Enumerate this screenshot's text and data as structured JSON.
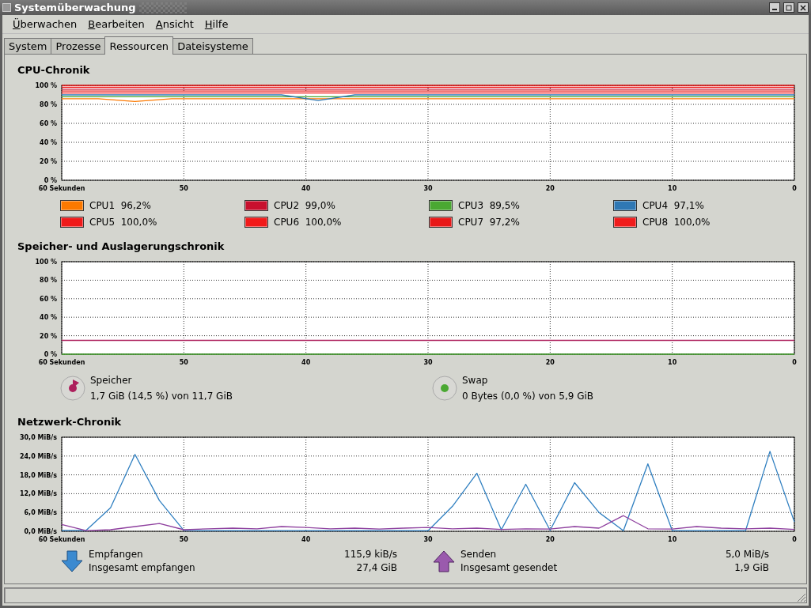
{
  "window": {
    "title": "Systemüberwachung"
  },
  "menu": [
    "Überwachen",
    "Bearbeiten",
    "Ansicht",
    "Hilfe"
  ],
  "tabs": [
    {
      "label": "System",
      "selected": false
    },
    {
      "label": "Prozesse",
      "selected": false
    },
    {
      "label": "Ressourcen",
      "selected": true
    },
    {
      "label": "Dateisysteme",
      "selected": false
    }
  ],
  "cpu": {
    "title": "CPU-Chronik",
    "chart_data": {
      "type": "line",
      "grid": true,
      "x": [
        60,
        57,
        54,
        51,
        48,
        45,
        42,
        39,
        36,
        33,
        30,
        27,
        24,
        21,
        18,
        15,
        12,
        9,
        6,
        3,
        0
      ],
      "xlim": [
        60,
        0
      ],
      "ylim": [
        0,
        100
      ],
      "xticks": [
        {
          "value": 60,
          "label": "60 Sekunden"
        },
        {
          "value": 50,
          "label": "50"
        },
        {
          "value": 40,
          "label": "40"
        },
        {
          "value": 30,
          "label": "30"
        },
        {
          "value": 20,
          "label": "20"
        },
        {
          "value": 10,
          "label": "10"
        },
        {
          "value": 0,
          "label": "0"
        }
      ],
      "yticks": [
        {
          "value": 0,
          "label": "0 %"
        },
        {
          "value": 20,
          "label": "20 %"
        },
        {
          "value": 40,
          "label": "40 %"
        },
        {
          "value": 60,
          "label": "60 %"
        },
        {
          "value": 80,
          "label": "80 %"
        },
        {
          "value": 100,
          "label": "100 %"
        }
      ],
      "series": [
        {
          "name": "CPU1",
          "color": "#fc7900",
          "values": [
            86,
            86,
            83,
            86,
            86,
            86,
            86,
            86,
            86,
            86,
            86,
            86,
            86,
            86,
            86,
            86,
            86,
            86,
            86,
            86,
            86
          ]
        },
        {
          "name": "CPU2",
          "color": "#c8102e",
          "values": [
            96,
            96,
            96,
            96,
            96,
            96,
            96,
            96,
            96,
            96,
            96,
            96,
            96,
            96,
            96,
            96,
            96,
            96,
            96,
            96,
            96
          ]
        },
        {
          "name": "CPU3",
          "color": "#4aa832",
          "values": [
            88,
            88,
            88,
            88,
            88,
            88,
            88,
            88,
            88,
            88,
            88,
            88,
            88,
            88,
            88,
            88,
            88,
            88,
            88,
            88,
            88
          ]
        },
        {
          "name": "CPU4",
          "color": "#2f78b4",
          "values": [
            90,
            90,
            90,
            90,
            90,
            90,
            90,
            84,
            90,
            90,
            90,
            90,
            90,
            90,
            90,
            90,
            90,
            90,
            90,
            90,
            90
          ]
        },
        {
          "name": "CPU5",
          "color": "#ef1a1a",
          "values": [
            98,
            98,
            98,
            98,
            98,
            98,
            98,
            98,
            98,
            98,
            98,
            98,
            98,
            98,
            98,
            98,
            98,
            98,
            98,
            98,
            98
          ]
        },
        {
          "name": "CPU6",
          "color": "#f21a1a",
          "values": [
            92,
            92,
            92,
            92,
            92,
            92,
            92,
            92,
            92,
            92,
            92,
            92,
            92,
            92,
            92,
            92,
            92,
            92,
            92,
            92,
            92
          ]
        },
        {
          "name": "CPU7",
          "color": "#e81818",
          "values": [
            94,
            94,
            94,
            94,
            94,
            94,
            94,
            94,
            94,
            94,
            94,
            94,
            94,
            94,
            94,
            94,
            94,
            94,
            94,
            94,
            94
          ]
        },
        {
          "name": "CPU8",
          "color": "#f01c1c",
          "values": [
            100,
            100,
            100,
            100,
            100,
            100,
            100,
            100,
            100,
            100,
            100,
            100,
            100,
            100,
            100,
            100,
            100,
            100,
            100,
            100,
            100
          ]
        }
      ]
    },
    "legend": [
      "96,2%",
      "99,0%",
      "89,5%",
      "97,1%",
      "100,0%",
      "100,0%",
      "97,2%",
      "100,0%"
    ]
  },
  "memory": {
    "title": "Speicher- und Auslagerungschronik",
    "chart_data": {
      "type": "line",
      "grid": true,
      "x": [
        60,
        0
      ],
      "xlim": [
        60,
        0
      ],
      "ylim": [
        0,
        100
      ],
      "xticks": [
        {
          "value": 60,
          "label": "60 Sekunden"
        },
        {
          "value": 50,
          "label": "50"
        },
        {
          "value": 40,
          "label": "40"
        },
        {
          "value": 30,
          "label": "30"
        },
        {
          "value": 20,
          "label": "20"
        },
        {
          "value": 10,
          "label": "10"
        },
        {
          "value": 0,
          "label": "0"
        }
      ],
      "yticks": [
        {
          "value": 0,
          "label": "0 %"
        },
        {
          "value": 20,
          "label": "20 %"
        },
        {
          "value": 40,
          "label": "40 %"
        },
        {
          "value": 60,
          "label": "60 %"
        },
        {
          "value": 80,
          "label": "80 %"
        },
        {
          "value": 100,
          "label": "100 %"
        }
      ],
      "series": [
        {
          "name": "Speicher",
          "color": "#ad1f5c",
          "values": [
            15,
            15
          ]
        },
        {
          "name": "Swap",
          "color": "#4aa832",
          "values": [
            0,
            0
          ]
        }
      ]
    },
    "legend": [
      "1,7 GiB (14,5 %) von 11,7 GiB",
      "0 Bytes (0,0 %) von 5,9 GiB"
    ]
  },
  "network": {
    "title": "Netzwerk-Chronik",
    "chart_data": {
      "type": "line",
      "grid": true,
      "x": [
        60,
        58,
        56,
        54,
        52,
        50,
        48,
        46,
        44,
        42,
        40,
        38,
        36,
        34,
        32,
        30,
        28,
        26,
        24,
        22,
        20,
        18,
        16,
        14,
        12,
        10,
        8,
        6,
        4,
        2,
        0
      ],
      "xlim": [
        60,
        0
      ],
      "ylim": [
        0,
        30
      ],
      "xticks": [
        {
          "value": 60,
          "label": "60 Sekunden"
        },
        {
          "value": 50,
          "label": "50"
        },
        {
          "value": 40,
          "label": "40"
        },
        {
          "value": 30,
          "label": "30"
        },
        {
          "value": 20,
          "label": "20"
        },
        {
          "value": 10,
          "label": "10"
        },
        {
          "value": 0,
          "label": "0"
        }
      ],
      "yticks": [
        {
          "value": 0,
          "label": "0,0 MiB/s"
        },
        {
          "value": 6,
          "label": "6,0 MiB/s"
        },
        {
          "value": 12,
          "label": "12,0 MiB/s"
        },
        {
          "value": 18,
          "label": "18,0 MiB/s"
        },
        {
          "value": 24,
          "label": "24,0 MiB/s"
        },
        {
          "value": 30,
          "label": "30,0 MiB/s"
        }
      ],
      "series": [
        {
          "name": "Empfangen",
          "color": "#2f7fc0",
          "values": [
            0.3,
            0.3,
            7.5,
            24.5,
            9.8,
            0.3,
            0.2,
            0.2,
            0.2,
            0.2,
            0.2,
            0.2,
            0.2,
            0.2,
            0.2,
            0.2,
            8,
            18.5,
            0.5,
            15,
            0.3,
            15.5,
            6,
            0.2,
            21.5,
            0.2,
            0.2,
            0.2,
            0.2,
            25.5,
            3
          ]
        },
        {
          "name": "Senden",
          "color": "#8e3f9e",
          "values": [
            2.2,
            0.2,
            0.5,
            1.5,
            2.5,
            0.5,
            0.8,
            1,
            0.8,
            1.5,
            1.2,
            0.8,
            1,
            0.7,
            1,
            1.2,
            0.8,
            1,
            0.6,
            0.8,
            0.7,
            1.5,
            1,
            5,
            0.8,
            0.7,
            1.5,
            1,
            0.8,
            1,
            0.6
          ]
        }
      ]
    },
    "legend": [
      {
        "kind": "down",
        "value": "115,9 kiB/s",
        "total_label": "Insgesamt empfangen",
        "total": "27,4 GiB"
      },
      {
        "kind": "up",
        "value": "5,0 MiB/s",
        "total_label": "Insgesamt gesendet",
        "total": "1,9 GiB"
      }
    ]
  }
}
